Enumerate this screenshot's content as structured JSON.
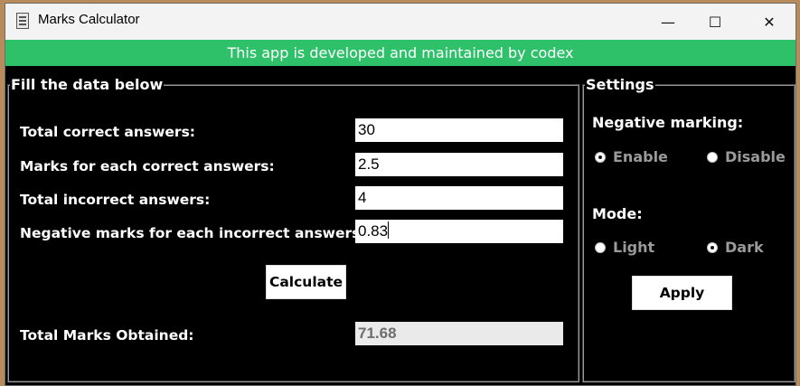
{
  "window": {
    "title": "Marks Calculator",
    "minimize_glyph": "—",
    "maximize_glyph": "☐",
    "close_glyph": "✕"
  },
  "banner": {
    "text": "This app is developed and maintained by codex",
    "color": "#2ec16a"
  },
  "form": {
    "legend": "Fill the data below",
    "correct_label": "Total correct answers:",
    "correct_value": "30",
    "marks_each_label": "Marks for each correct answers:",
    "marks_each_value": "2.5",
    "incorrect_label": "Total incorrect answers:",
    "incorrect_value": "4",
    "negative_label": "Negative marks for each incorrect answers:",
    "negative_value": "0.83",
    "calculate_label": "Calculate",
    "result_label": "Total Marks Obtained:",
    "result_value": "71.68"
  },
  "settings": {
    "legend": "Settings",
    "negative_marking_label": "Negative marking:",
    "enable_label": "Enable",
    "disable_label": "Disable",
    "negative_marking_selected": "Enable",
    "mode_label": "Mode:",
    "light_label": "Light",
    "dark_label": "Dark",
    "mode_selected": "Dark",
    "apply_label": "Apply"
  }
}
